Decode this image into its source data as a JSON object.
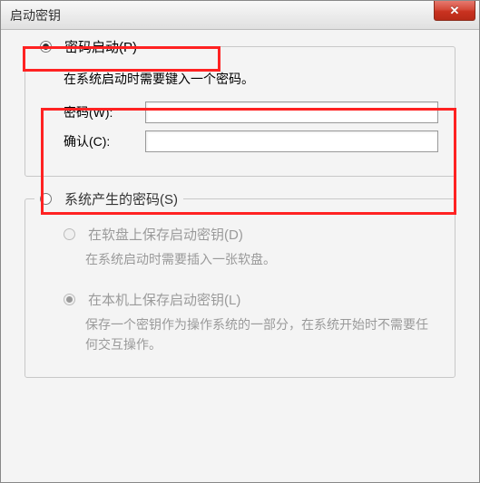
{
  "window": {
    "title": "启动密钥",
    "close_label": "✕"
  },
  "section_password": {
    "legend": "密码启动(P)",
    "desc": "在系统启动时需要键入一个密码。",
    "password_label": "密码(W):",
    "confirm_label": "确认(C):",
    "password_value": "",
    "confirm_value": ""
  },
  "section_system": {
    "legend": "系统产生的密码(S)",
    "opt_floppy_label": "在软盘上保存启动密钥(D)",
    "opt_floppy_desc": "在系统启动时需要插入一张软盘。",
    "opt_local_label": "在本机上保存启动密钥(L)",
    "opt_local_desc": "保存一个密钥作为操作系统的一部分，在系统开始时不需要任何交互操作。"
  }
}
